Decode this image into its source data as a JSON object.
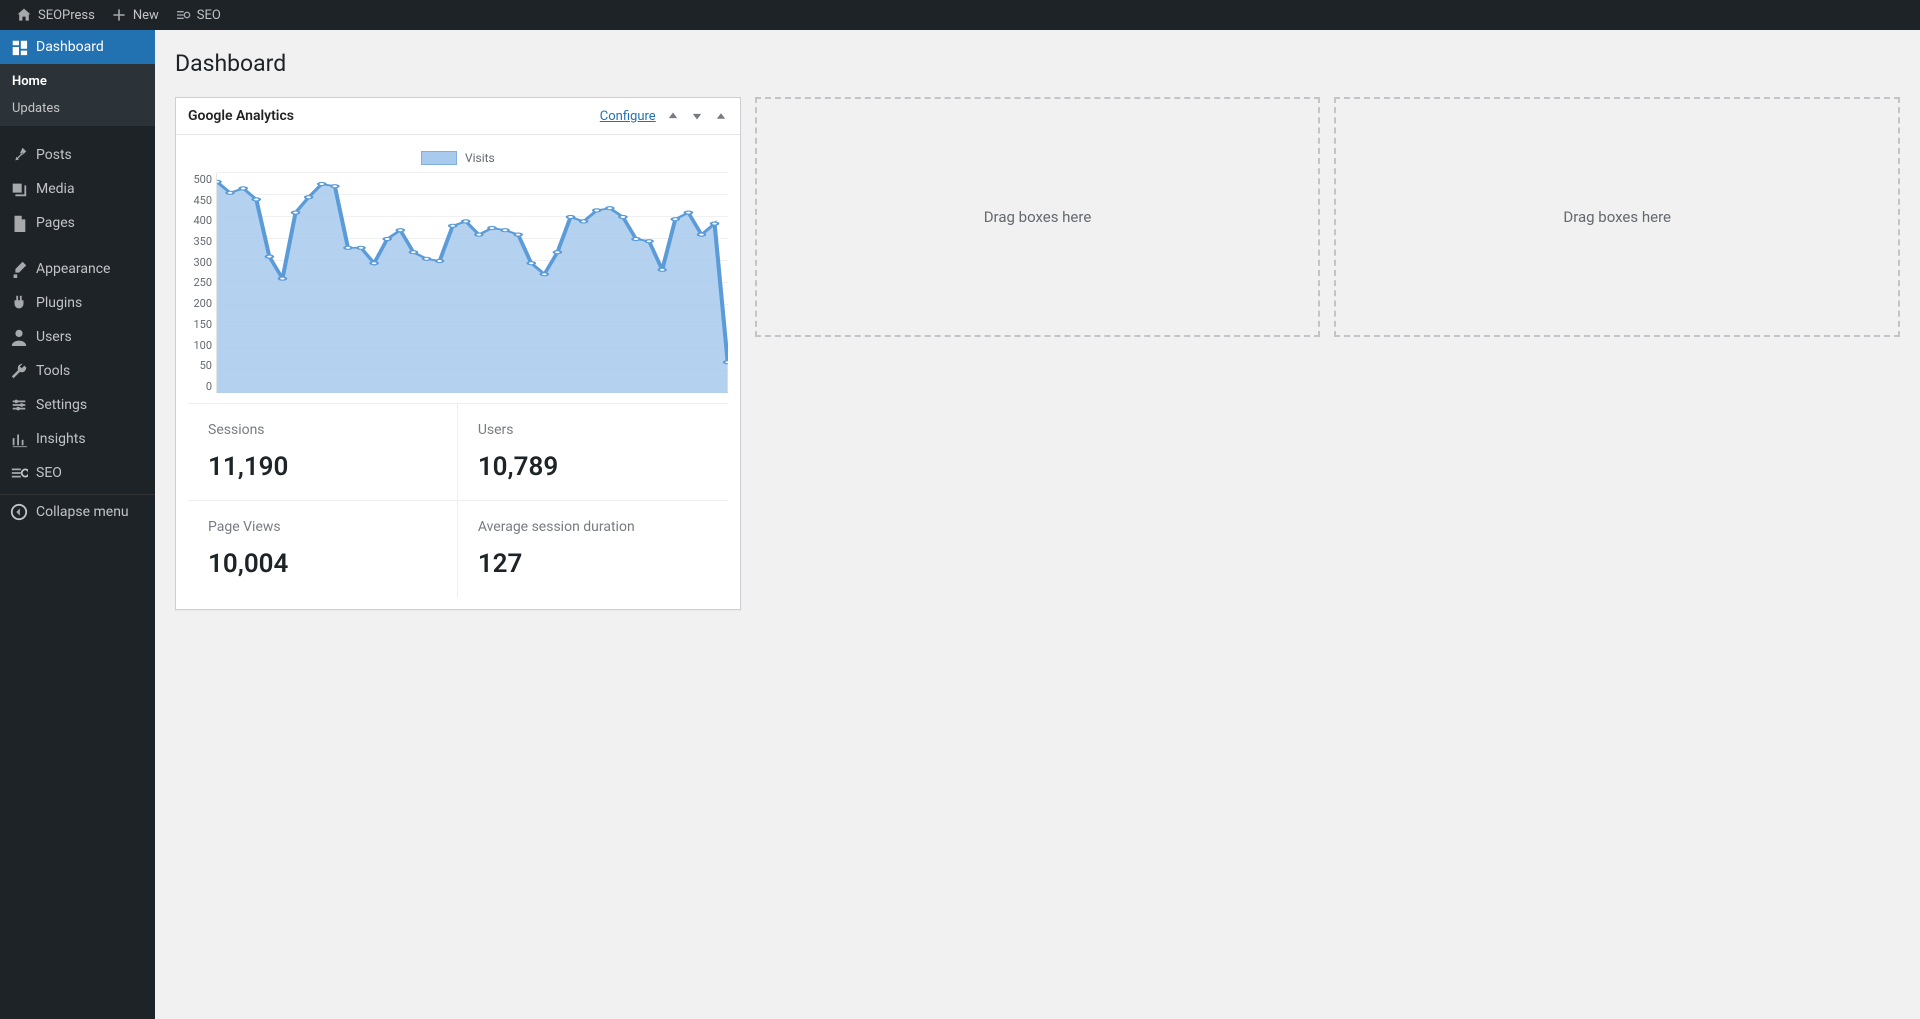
{
  "adminbar": {
    "site_name": "SEOPress",
    "new_label": "New",
    "seo_label": "SEO"
  },
  "sidebar": {
    "items": [
      {
        "id": "dashboard",
        "label": "Dashboard",
        "icon": "dashboard",
        "current": true,
        "submenu": [
          {
            "label": "Home",
            "current": true
          },
          {
            "label": "Updates"
          }
        ]
      },
      {
        "sep": true
      },
      {
        "id": "posts",
        "label": "Posts",
        "icon": "pin"
      },
      {
        "id": "media",
        "label": "Media",
        "icon": "media"
      },
      {
        "id": "pages",
        "label": "Pages",
        "icon": "page"
      },
      {
        "sep": true
      },
      {
        "id": "appearance",
        "label": "Appearance",
        "icon": "brush"
      },
      {
        "id": "plugins",
        "label": "Plugins",
        "icon": "plug"
      },
      {
        "id": "users",
        "label": "Users",
        "icon": "user"
      },
      {
        "id": "tools",
        "label": "Tools",
        "icon": "wrench"
      },
      {
        "id": "settings",
        "label": "Settings",
        "icon": "sliders"
      },
      {
        "id": "insights",
        "label": "Insights",
        "icon": "chart"
      },
      {
        "id": "seo",
        "label": "SEO",
        "icon": "seo"
      }
    ],
    "collapse_label": "Collapse menu"
  },
  "page": {
    "title": "Dashboard"
  },
  "widget": {
    "title": "Google Analytics",
    "configure_label": "Configure",
    "legend_label": "Visits",
    "stats": [
      {
        "label": "Sessions",
        "value": "11,190"
      },
      {
        "label": "Users",
        "value": "10,789"
      },
      {
        "label": "Page Views",
        "value": "10,004"
      },
      {
        "label": "Average session duration",
        "value": "127"
      }
    ]
  },
  "dropzone_text": "Drag boxes here",
  "chart_data": {
    "type": "area",
    "title": "Visits",
    "ylabel": "",
    "ylim": [
      0,
      500
    ],
    "y_ticks": [
      0,
      50,
      100,
      150,
      200,
      250,
      300,
      350,
      400,
      450,
      500
    ],
    "values": [
      480,
      455,
      465,
      440,
      310,
      260,
      410,
      445,
      475,
      470,
      330,
      330,
      295,
      350,
      370,
      320,
      305,
      300,
      380,
      390,
      360,
      375,
      370,
      360,
      295,
      270,
      320,
      400,
      390,
      415,
      420,
      400,
      350,
      345,
      280,
      395,
      410,
      360,
      385,
      70
    ]
  }
}
